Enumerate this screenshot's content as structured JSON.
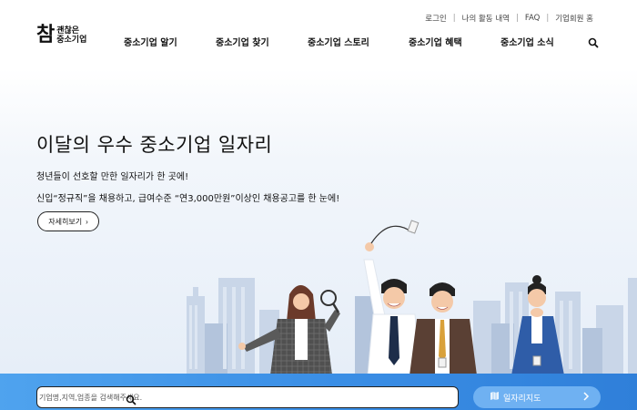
{
  "logo": {
    "big": "참",
    "line1": "괜찮은",
    "line2": "중소기업"
  },
  "util_links": [
    "로그인",
    "나의 활동 내역",
    "FAQ",
    "기업회원 홈"
  ],
  "gnb": [
    "중소기업 알기",
    "중소기업 찾기",
    "중소기업 스토리",
    "중소기업 혜택",
    "중소기업 소식"
  ],
  "hero": {
    "title": "이달의 우수 중소기업 일자리",
    "sub1": "청년들이 선호할 만한 일자리가 한 곳에!",
    "sub2": "신입“정규직”을 채용하고, 급여수준 “연3,000만원”이상인 채용공고를 한 눈에!",
    "more_label": "자세히보기",
    "more_arrow": "›"
  },
  "search": {
    "placeholder": "기업명,지역,업종을 검색해주세요."
  },
  "map_button": {
    "label": "일자리지도",
    "arrow": "›"
  },
  "colors": {
    "accent_blue": "#3b8ee8",
    "map_button": "#6fb1f2",
    "hero_bg": "#e6eef8"
  },
  "icons": [
    "search-icon",
    "map-icon",
    "chevron-right-icon"
  ]
}
